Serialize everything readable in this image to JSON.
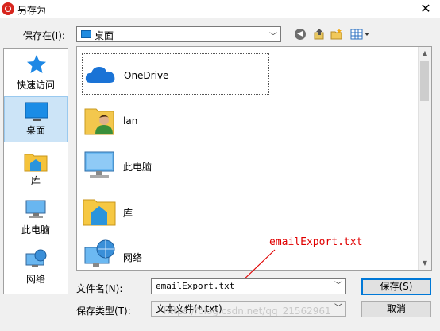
{
  "titlebar": {
    "title": "另存为",
    "close_label": "✕"
  },
  "toolbar": {
    "save_in_label": "保存在(I):",
    "location": "桌面"
  },
  "places": [
    {
      "label": "快速访问",
      "icon": "star-icon"
    },
    {
      "label": "桌面",
      "icon": "desktop-icon",
      "selected": true
    },
    {
      "label": "库",
      "icon": "library-icon"
    },
    {
      "label": "此电脑",
      "icon": "computer-icon"
    },
    {
      "label": "网络",
      "icon": "network-icon"
    }
  ],
  "files": [
    {
      "name": "OneDrive",
      "icon": "onedrive-icon"
    },
    {
      "name": "lan",
      "icon": "user-folder-icon"
    },
    {
      "name": "此电脑",
      "icon": "computer-icon"
    },
    {
      "name": "库",
      "icon": "library-icon"
    },
    {
      "name": "网络",
      "icon": "network-icon"
    }
  ],
  "form": {
    "filename_label": "文件名(N):",
    "filename_value": "emailExport.txt",
    "filetype_label": "保存类型(T):",
    "filetype_value": "文本文件(*.txt)",
    "save_button": "保存(S)",
    "cancel_button": "取消"
  },
  "annotation": {
    "text": "emailExport.txt",
    "color": "#e00000"
  },
  "watermark": "https://blog.csdn.net/qq_21562961"
}
